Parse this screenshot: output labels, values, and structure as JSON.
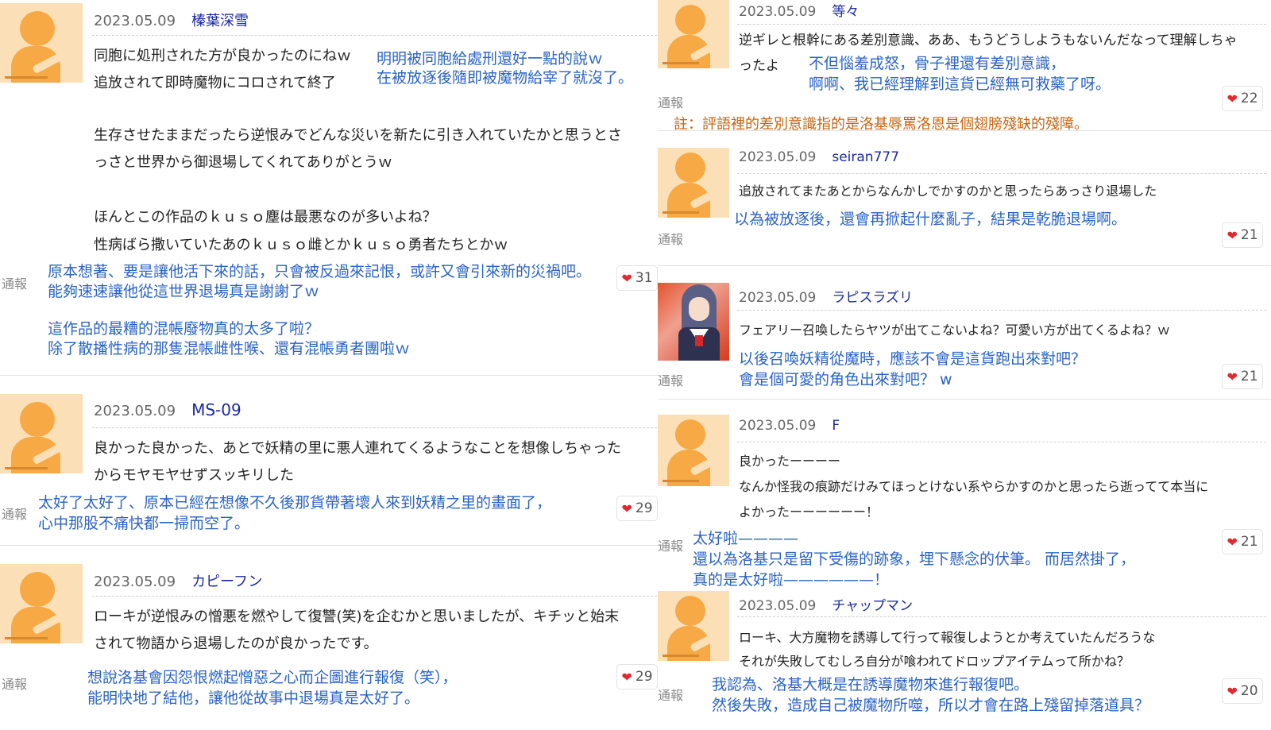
{
  "ui": {
    "report_label": "通報",
    "heart_glyph": "❤",
    "heart_color": "#e0282e",
    "username_color": "#1a2aa3",
    "translation_color": "#2a63c6",
    "note_color": "#c8650f"
  },
  "comments": [
    {
      "date": "2023.05.09",
      "user": "榛葉深雪",
      "likes": "31",
      "jp": [
        "同胞に処刑された方が良かったのにねｗ",
        "追放されて即時魔物にコロされて終了",
        "生存させたままだったら逆恨みでどんな災いを新たに引き入れていたかと思うとさ",
        "っさと世界から御退場してくれてありがとうｗ",
        "ほんとこの作品のｋｕｓｏ塵は最悪なのが多いよね？",
        "性病ばら撒いていたあのｋｕｓｏ雌とかｋｕｓｏ勇者たちとかｗ"
      ],
      "zh": [
        "明明被同胞給處刑還好一點的說ｗ",
        "在被放逐後隨即被魔物給宰了就沒了。",
        "原本想著、要是讓他活下來的話，只會被反過來記恨，或許又會引來新的災禍吧。",
        "能夠速速讓他從這世界退場真是謝謝了ｗ",
        "這作品的最糟的混帳廢物真的太多了啦？",
        "除了散播性病的那隻混帳雌性喉、還有混帳勇者團啦ｗ"
      ]
    },
    {
      "date": "2023.05.09",
      "user": "MS-09",
      "likes": "29",
      "jp": [
        "良かった良かった、あとで妖精の里に悪人連れてくるようなことを想像しちゃった",
        "からモヤモヤせずスッキリした"
      ],
      "zh": [
        "太好了太好了、原本已經在想像不久後那貨帶著壞人來到妖精之里的畫面了，",
        "心中那股不痛快都一掃而空了。"
      ]
    },
    {
      "date": "2023.05.09",
      "user": "カピーフン",
      "likes": "29",
      "jp": [
        "ローキが逆恨みの憎悪を燃やして復讐(笑)を企むかと思いましたが、キチッと始末",
        "されて物語から退場したのが良かったです。"
      ],
      "zh": [
        "想說洛基會因怨恨燃起憎惡之心而企圖進行報復（笑），",
        "能明快地了結他，讓他從故事中退場真是太好了。"
      ]
    },
    {
      "date": "2023.05.09",
      "user": "等々",
      "likes": "22",
      "jp": [
        "逆ギレと根幹にある差別意識、ああ、もうどうしようもないんだなって理解しちゃ",
        "ったよ"
      ],
      "zh": [
        "不但惱羞成怒，骨子裡還有差別意識，",
        "啊啊、我已經理解到這貨已經無可救藥了呀。"
      ],
      "note": "註：評語裡的差別意識指的是洛基辱罵洛恩是個翅膀殘缺的殘障。"
    },
    {
      "date": "2023.05.09",
      "user": "seiran777",
      "likes": "21",
      "jp": [
        "追放されてまたあとからなんかしでかすのかと思ったらあっさり退場した"
      ],
      "zh": [
        "以為被放逐後，還會再掀起什麼亂子，結果是乾脆退場啊。"
      ]
    },
    {
      "date": "2023.05.09",
      "user": "ラピスラズリ",
      "likes": "21",
      "jp": [
        "フェアリー召喚したらヤツが出てこないよね？可愛い方が出てくるよね？ｗ"
      ],
      "zh": [
        "以後召喚妖精從魔時，應該不會是這貨跑出來對吧？",
        "會是個可愛的角色出來對吧？ w"
      ]
    },
    {
      "date": "2023.05.09",
      "user": "F",
      "likes": "21",
      "jp": [
        "良かったーーーー",
        "なんか怪我の痕跡だけみてほっとけない系やらかすのかと思ったら逝ってて本当に",
        "よかったーーーーーー！"
      ],
      "zh": [
        "太好啦————",
        "還以為洛基只是留下受傷的跡象，埋下懸念的伏筆。 而居然掛了，",
        "真的是太好啦——————！"
      ]
    },
    {
      "date": "2023.05.09",
      "user": "チャップマン",
      "likes": "20",
      "jp": [
        "ローキ、大方魔物を誘導して行って報復しようとか考えていたんだろうな",
        "それが失敗してむしろ自分が喰われてドロップアイテムって所かね？"
      ],
      "zh": [
        "我認為、洛基大概是在誘導魔物來進行報復吧。",
        "然後失敗，造成自己被魔物所噬，所以才會在路上殘留掉落道具？"
      ]
    }
  ]
}
